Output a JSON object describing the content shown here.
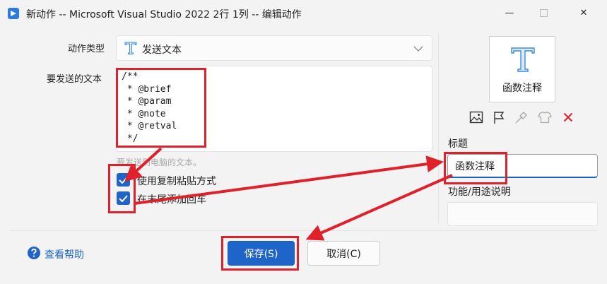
{
  "window": {
    "title": "新动作 -- Microsoft Visual Studio 2022 2行 1列 -- 编辑动作",
    "min_glyph": "—",
    "close_glyph": "✕"
  },
  "form": {
    "action_type_label": "动作类型",
    "action_type_value": "发送文本",
    "text_label": "要发送的文本",
    "text_lines": [
      "/**",
      " * @brief",
      " * @param",
      " * @note",
      " * @retval",
      " */"
    ],
    "hint": "要发送到电脑的文本。",
    "use_clipboard_label": "使用复制粘贴方式",
    "use_clipboard_checked": true,
    "append_enter_label": "在末尾添加回车",
    "append_enter_checked": true
  },
  "panel": {
    "preview_label": "函数注释",
    "title_label": "标题",
    "title_value": "函数注释",
    "desc_label": "功能/用途说明",
    "desc_value": ""
  },
  "footer": {
    "help_label": "查看帮助",
    "save_label": "保存(S)",
    "cancel_label": "取消(C)"
  },
  "colors": {
    "accent": "#1f64c8",
    "annotation": "#e0202a",
    "delete": "#e0202a"
  }
}
